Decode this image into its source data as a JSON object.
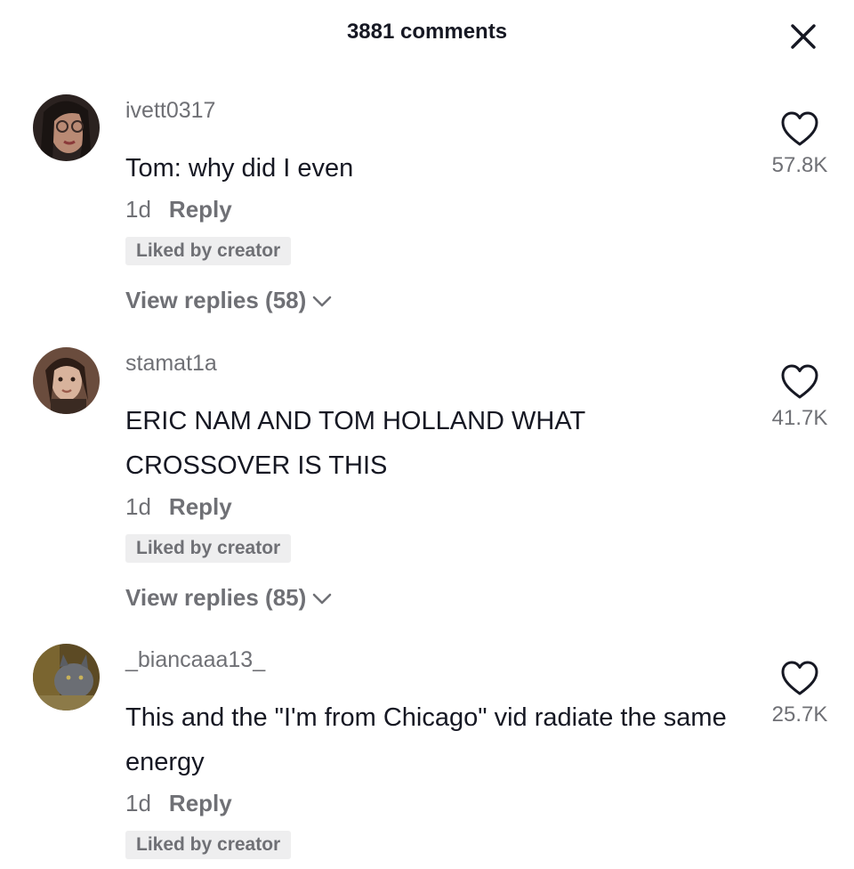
{
  "header": {
    "title": "3881 comments",
    "close_icon": "close-icon"
  },
  "comments": [
    {
      "username": "ivett0317",
      "text": "Tom: why did I even",
      "time": "1d",
      "reply_label": "Reply",
      "badge": "Liked by creator",
      "view_replies": "View replies (58)",
      "likes": "57.8K"
    },
    {
      "username": "stamat1a",
      "text": "ERIC NAM AND TOM HOLLAND WHAT CROSSOVER IS THIS",
      "time": "1d",
      "reply_label": "Reply",
      "badge": "Liked by creator",
      "view_replies": "View replies (85)",
      "likes": "41.7K"
    },
    {
      "username": "_biancaaa13_",
      "text": "This and the \"I'm from Chicago\" vid radiate the same energy",
      "time": "1d",
      "reply_label": "Reply",
      "badge": "Liked by creator",
      "likes": "25.7K"
    }
  ],
  "colors": {
    "primary_text": "#161823",
    "secondary_text": "#6f7075",
    "badge_bg": "#eeeeef"
  },
  "icons": [
    "close-icon",
    "heart-outline-icon",
    "chevron-down-icon"
  ]
}
